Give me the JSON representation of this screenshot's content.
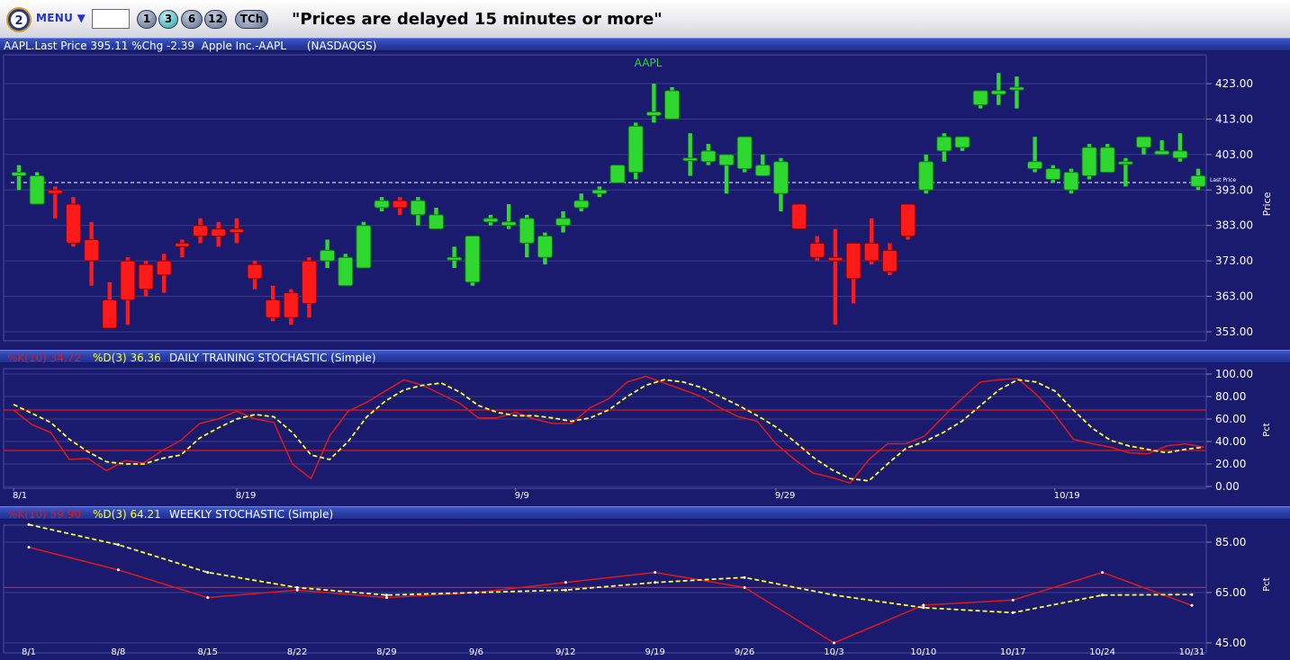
{
  "toolbar": {
    "menu_label": "MENU ▼",
    "symbol_value": "",
    "period_buttons": [
      "1",
      "3",
      "6",
      "12"
    ],
    "selected_period": "3",
    "tch_label": "TCh",
    "delay_notice": "\"Prices are delayed 15 minutes or more\""
  },
  "header": {
    "quote_text": "AAPL.Last Price 395.11 %Chg -2.39  Apple Inc.-AAPL      (NASDAQGS)"
  },
  "daily_header": {
    "k_text": "%K(10) 34.72",
    "d_text": "%D(3) 36.36",
    "title": "DAILY TRAINING STOCHASTIC (Simple)"
  },
  "weekly_header": {
    "k_text": "%K(10) 59.90",
    "d_text": "%D(3) 64.21",
    "title": "WEEKLY STOCHASTIC (Simple)"
  },
  "colors": {
    "background": "#1a1b6e",
    "up": "#2fd82f",
    "down": "#ff1a1a",
    "k_line": "#e01818",
    "d_line": "#ffff33",
    "axis_text": "#ffffff",
    "grid": "#3a3c8c"
  },
  "chart_data": [
    {
      "type": "candlestick",
      "title": "AAPL",
      "ylabel": "Price",
      "y_ticks": [
        423,
        413,
        403,
        393,
        383,
        373,
        363,
        353
      ],
      "y_tick_labels": [
        "423.00",
        "413.00",
        "403.00",
        "393.00",
        "383.00",
        "373.00",
        "363.00",
        "353.00"
      ],
      "ylim": [
        353,
        423
      ],
      "last_price": 395.11,
      "last_price_label": "Last Price",
      "candles": [
        {
          "o": 397,
          "h": 400,
          "l": 393,
          "c": 398
        },
        {
          "o": 389,
          "h": 398,
          "l": 389,
          "c": 397
        },
        {
          "o": 393,
          "h": 394,
          "l": 385,
          "c": 392
        },
        {
          "o": 389,
          "h": 391,
          "l": 377,
          "c": 378
        },
        {
          "o": 379,
          "h": 384,
          "l": 366,
          "c": 373
        },
        {
          "o": 362,
          "h": 367,
          "l": 354,
          "c": 354
        },
        {
          "o": 373,
          "h": 374,
          "l": 355,
          "c": 362
        },
        {
          "o": 372,
          "h": 373,
          "l": 363,
          "c": 365
        },
        {
          "o": 373,
          "h": 375,
          "l": 364,
          "c": 369
        },
        {
          "o": 378,
          "h": 379,
          "l": 374,
          "c": 377
        },
        {
          "o": 383,
          "h": 385,
          "l": 378,
          "c": 380
        },
        {
          "o": 382,
          "h": 384,
          "l": 377,
          "c": 380
        },
        {
          "o": 382,
          "h": 385,
          "l": 378,
          "c": 381
        },
        {
          "o": 372,
          "h": 373,
          "l": 365,
          "c": 368
        },
        {
          "o": 362,
          "h": 366,
          "l": 356,
          "c": 357
        },
        {
          "o": 364,
          "h": 365,
          "l": 355,
          "c": 357
        },
        {
          "o": 373,
          "h": 374,
          "l": 357,
          "c": 361
        },
        {
          "o": 373,
          "h": 379,
          "l": 371,
          "c": 376
        },
        {
          "o": 366,
          "h": 375,
          "l": 366,
          "c": 374
        },
        {
          "o": 371,
          "h": 384,
          "l": 371,
          "c": 383
        },
        {
          "o": 388,
          "h": 391,
          "l": 387,
          "c": 390
        },
        {
          "o": 390,
          "h": 391,
          "l": 386,
          "c": 388
        },
        {
          "o": 386,
          "h": 391,
          "l": 383,
          "c": 390
        },
        {
          "o": 382,
          "h": 388,
          "l": 382,
          "c": 386
        },
        {
          "o": 374,
          "h": 377,
          "l": 371,
          "c": 374
        },
        {
          "o": 367,
          "h": 380,
          "l": 366,
          "c": 380
        },
        {
          "o": 384,
          "h": 386,
          "l": 383,
          "c": 385
        },
        {
          "o": 383,
          "h": 389,
          "l": 382,
          "c": 384
        },
        {
          "o": 378,
          "h": 386,
          "l": 374,
          "c": 385
        },
        {
          "o": 374,
          "h": 381,
          "l": 372,
          "c": 380
        },
        {
          "o": 383,
          "h": 387,
          "l": 381,
          "c": 385
        },
        {
          "o": 388,
          "h": 392,
          "l": 387,
          "c": 390
        },
        {
          "o": 392,
          "h": 394,
          "l": 391,
          "c": 393
        },
        {
          "o": 395,
          "h": 400,
          "l": 395,
          "c": 400
        },
        {
          "o": 398,
          "h": 412,
          "l": 396,
          "c": 411
        },
        {
          "o": 414,
          "h": 423,
          "l": 412,
          "c": 415
        },
        {
          "o": 413,
          "h": 422,
          "l": 413,
          "c": 421
        },
        {
          "o": 402,
          "h": 409,
          "l": 397,
          "c": 402
        },
        {
          "o": 401,
          "h": 406,
          "l": 400,
          "c": 404
        },
        {
          "o": 400,
          "h": 403,
          "l": 392,
          "c": 403
        },
        {
          "o": 399,
          "h": 408,
          "l": 398,
          "c": 408
        },
        {
          "o": 397,
          "h": 403,
          "l": 397,
          "c": 400
        },
        {
          "o": 392,
          "h": 402,
          "l": 387,
          "c": 401
        },
        {
          "o": 389,
          "h": 389,
          "l": 382,
          "c": 382
        },
        {
          "o": 378,
          "h": 380,
          "l": 373,
          "c": 374
        },
        {
          "o": 374,
          "h": 382,
          "l": 355,
          "c": 373
        },
        {
          "o": 378,
          "h": 378,
          "l": 361,
          "c": 368
        },
        {
          "o": 378,
          "h": 385,
          "l": 372,
          "c": 373
        },
        {
          "o": 376,
          "h": 378,
          "l": 369,
          "c": 370
        },
        {
          "o": 389,
          "h": 389,
          "l": 379,
          "c": 380
        },
        {
          "o": 393,
          "h": 403,
          "l": 392,
          "c": 401
        },
        {
          "o": 404,
          "h": 409,
          "l": 401,
          "c": 408
        },
        {
          "o": 405,
          "h": 408,
          "l": 404,
          "c": 408
        },
        {
          "o": 417,
          "h": 420,
          "l": 416,
          "c": 421
        },
        {
          "o": 420,
          "h": 426,
          "l": 417,
          "c": 421
        },
        {
          "o": 422,
          "h": 425,
          "l": 416,
          "c": 422
        },
        {
          "o": 399,
          "h": 408,
          "l": 398,
          "c": 401
        },
        {
          "o": 396,
          "h": 400,
          "l": 395,
          "c": 399
        },
        {
          "o": 393,
          "h": 399,
          "l": 392,
          "c": 398
        },
        {
          "o": 397,
          "h": 406,
          "l": 396,
          "c": 405
        },
        {
          "o": 398,
          "h": 406,
          "l": 398,
          "c": 405
        },
        {
          "o": 401,
          "h": 402,
          "l": 394,
          "c": 401
        },
        {
          "o": 405,
          "h": 408,
          "l": 403,
          "c": 408
        },
        {
          "o": 403,
          "h": 407,
          "l": 403,
          "c": 404
        },
        {
          "o": 402,
          "h": 409,
          "l": 401,
          "c": 404
        },
        {
          "o": 394,
          "h": 399,
          "l": 393,
          "c": 397
        }
      ]
    },
    {
      "type": "line",
      "title": "DAILY TRAINING STOCHASTIC (Simple)",
      "ylabel": "Pct",
      "ylim": [
        0,
        100
      ],
      "y_ticks": [
        100,
        80,
        60,
        40,
        20,
        0
      ],
      "y_tick_labels": [
        "100.00",
        "80.00",
        "60.00",
        "40.00",
        "20.00",
        "0.00"
      ],
      "x_ticks": [
        {
          "label": "8/1",
          "index": 0
        },
        {
          "label": "8/19",
          "index": 12
        },
        {
          "label": "9/9",
          "index": 27
        },
        {
          "label": "9/29",
          "index": 41
        },
        {
          "label": "10/19",
          "index": 56
        }
      ],
      "reference_lines": [
        68,
        32
      ],
      "series": [
        {
          "name": "%K(10)",
          "style": "solid",
          "values": [
            68,
            55,
            48,
            24,
            25,
            14,
            23,
            21,
            32,
            41,
            56,
            60,
            67,
            60,
            57,
            20,
            7,
            45,
            67,
            75,
            85,
            95,
            90,
            82,
            74,
            61,
            61,
            66,
            60,
            56,
            56,
            70,
            78,
            93,
            98,
            92,
            86,
            80,
            70,
            62,
            58,
            38,
            24,
            12,
            8,
            3,
            24,
            38,
            38,
            45,
            62,
            78,
            93,
            95,
            96,
            82,
            64,
            42,
            38,
            35,
            30,
            29,
            36,
            38,
            35
          ]
        },
        {
          "name": "%D(3)",
          "style": "dashed",
          "values": [
            73,
            65,
            57,
            42,
            31,
            22,
            20,
            20,
            25,
            28,
            43,
            52,
            60,
            64,
            62,
            48,
            28,
            24,
            40,
            62,
            76,
            86,
            90,
            92,
            84,
            72,
            66,
            63,
            63,
            61,
            58,
            61,
            68,
            80,
            90,
            95,
            93,
            88,
            80,
            72,
            63,
            53,
            40,
            26,
            15,
            7,
            5,
            20,
            34,
            40,
            48,
            58,
            72,
            86,
            95,
            93,
            85,
            68,
            52,
            41,
            36,
            33,
            30,
            33,
            35
          ]
        }
      ]
    },
    {
      "type": "line",
      "title": "WEEKLY STOCHASTIC (Simple)",
      "ylabel": "Pct",
      "ylim": [
        45,
        85
      ],
      "y_ticks": [
        85,
        65,
        45
      ],
      "y_tick_labels": [
        "85.00",
        "65.00",
        "45.00"
      ],
      "x_ticks": [
        "8/1",
        "8/8",
        "8/15",
        "8/22",
        "8/29",
        "9/6",
        "9/12",
        "9/19",
        "9/26",
        "10/3",
        "10/10",
        "10/17",
        "10/24",
        "10/31"
      ],
      "reference_lines": [
        67
      ],
      "series": [
        {
          "name": "%K(10)",
          "style": "solid",
          "values": [
            83,
            74,
            63,
            66,
            63,
            65,
            69,
            73,
            67,
            45,
            60,
            62,
            73,
            59.9
          ]
        },
        {
          "name": "%D(3)",
          "style": "dashed",
          "values": [
            92,
            84,
            73,
            67,
            64,
            65,
            66,
            69,
            71,
            64,
            59,
            57,
            64,
            64.21
          ]
        }
      ]
    }
  ]
}
